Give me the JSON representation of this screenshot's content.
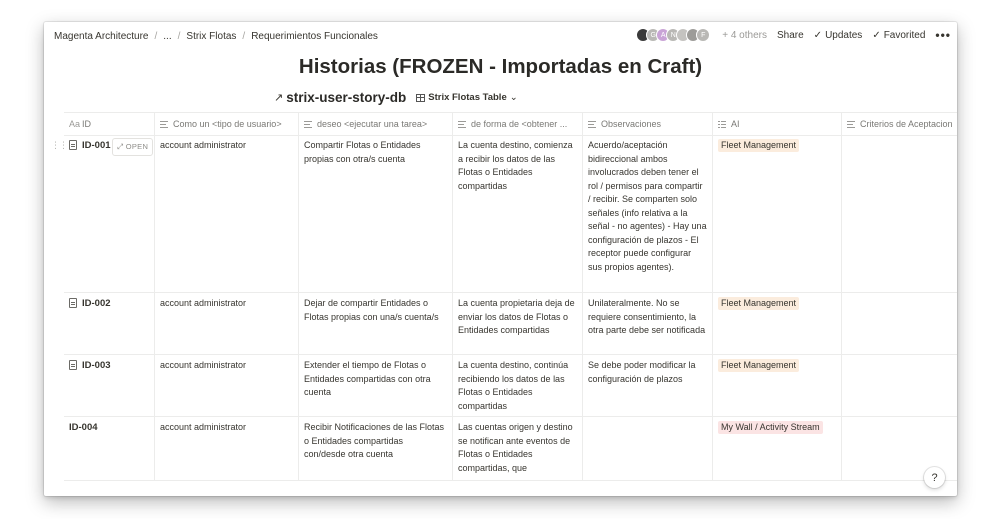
{
  "breadcrumbs": [
    "Magenta Architecture",
    "...",
    "Strix Flotas",
    "Requerimientos Funcionales"
  ],
  "topbar": {
    "avatars": [
      {
        "letter": "",
        "color": "#3a3a3a"
      },
      {
        "letter": "G",
        "color": "#b9b8b5"
      },
      {
        "letter": "A",
        "color": "#c9a4d6"
      },
      {
        "letter": "N",
        "color": "#b9b8b5"
      },
      {
        "letter": "",
        "color": "#c4c3c0"
      },
      {
        "letter": "",
        "color": "#9d9c99"
      },
      {
        "letter": "F",
        "color": "#b9b8b5"
      }
    ],
    "others": "+ 4 others",
    "share": "Share",
    "updates": "Updates",
    "favorited": "Favorited",
    "more": "•••"
  },
  "page_title": "Historias  (FROZEN - Importadas en Craft)",
  "database": {
    "name": "strix-user-story-db",
    "view": "Strix Flotas Table"
  },
  "columns": [
    {
      "icon": "Aa",
      "label": "ID"
    },
    {
      "icon": "lines",
      "label": "Como un <tipo de usuario>"
    },
    {
      "icon": "lines",
      "label": "deseo <ejecutar una tarea>"
    },
    {
      "icon": "lines",
      "label": "de forma de <obtener ..."
    },
    {
      "icon": "lines",
      "label": "Observaciones"
    },
    {
      "icon": "list",
      "label": "AI"
    },
    {
      "icon": "lines",
      "label": "Criterios de Aceptacion"
    }
  ],
  "open_label": "OPEN",
  "rows": [
    {
      "id": "ID-001",
      "como": "account administrator",
      "deseo": "Compartir Flotas o Entidades propias con otra/s cuenta",
      "forma": "La cuenta destino, comienza a recibir los datos de las Flotas o Entidades compartidas",
      "obs": "Acuerdo/aceptación bidireccional ambos involucrados deben tener el rol / permisos para compartir / recibir. Se comparten solo señales (info relativa a la señal - no agentes) - Hay una configuración de plazos - El receptor puede configurar sus propios agentes).",
      "ai": "Fleet Management",
      "ai_color": "#fbecdd"
    },
    {
      "id": "ID-002",
      "como": "account administrator",
      "deseo": "Dejar de compartir Entidades o Flotas propias con una/s cuenta/s",
      "forma": "La cuenta propietaria deja de enviar los datos de Flotas o Entidades compartidas",
      "obs": "Unilateralmente. No se requiere consentimiento, la otra parte debe ser notificada",
      "ai": "Fleet Management",
      "ai_color": "#fbecdd"
    },
    {
      "id": "ID-003",
      "como": "account administrator",
      "deseo": "Extender el tiempo de Flotas o Entidades compartidas con otra cuenta",
      "forma": "La cuenta destino, continúa recibiendo los datos de las Flotas o Entidades compartidas",
      "obs": "Se debe poder modificar la configuración de plazos",
      "ai": "Fleet Management",
      "ai_color": "#fbecdd"
    },
    {
      "id": "ID-004",
      "como": "account administrator",
      "deseo": "Recibir Notificaciones de las Flotas o Entidades compartidas con/desde otra cuenta",
      "forma": "Las cuentas origen y destino se notifican ante eventos de Flotas o Entidades compartidas, que",
      "obs": "",
      "ai": "My Wall / Activity Stream",
      "ai_color": "#fbe4e4"
    }
  ],
  "help": "?"
}
